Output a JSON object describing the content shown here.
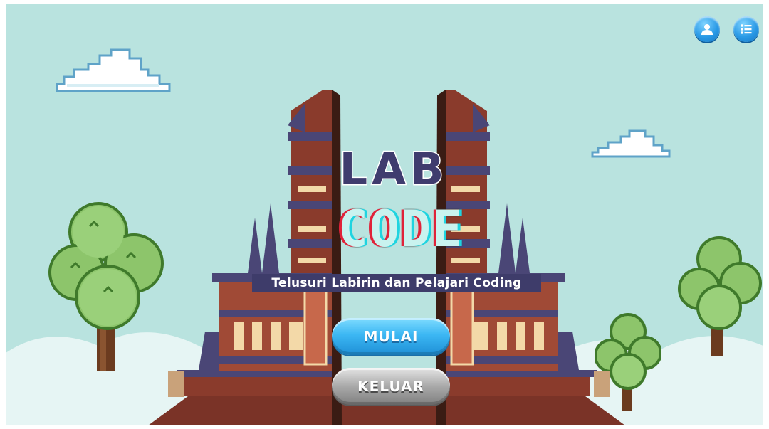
{
  "game": {
    "title_line1": "LAB",
    "title_line2": "CODE",
    "tagline": "Telusuri Labirin dan Pelajari Coding"
  },
  "menu": {
    "start_label": "MULAI",
    "exit_label": "KELUAR"
  },
  "top_bar": {
    "profile_icon": "user-icon",
    "menu_icon": "list-icon"
  },
  "colors": {
    "sky": "#b9e3df",
    "title_dark": "#3f3c6e",
    "code_red": "#e0233a",
    "code_cyan": "#1fd4e0",
    "button_blue": "#3cb7f3",
    "button_grey": "#a9a9a9",
    "gate_brick": "#8a3b2c",
    "gate_purple": "#4a4676"
  }
}
